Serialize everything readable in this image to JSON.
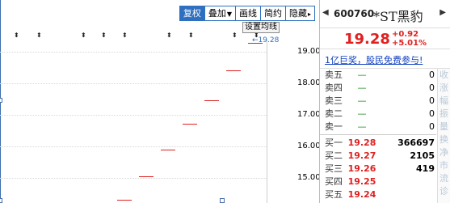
{
  "toolbar": {
    "items": [
      {
        "label": "复权",
        "active": true
      },
      {
        "label": "叠加",
        "caret": "▼"
      },
      {
        "label": "画线"
      },
      {
        "label": "简约"
      },
      {
        "label": "隐藏",
        "caret": "▸"
      }
    ]
  },
  "chart": {
    "set_ma_label": "设置均线",
    "high_label": "19.28",
    "y_ticks": [
      "19.00",
      "18.00",
      "17.00",
      "16.00",
      "15.00"
    ],
    "marker_glyph": "⬍"
  },
  "chart_data": {
    "type": "line",
    "title": "",
    "xlabel": "",
    "ylabel": "",
    "ylim": [
      14.2,
      19.4
    ],
    "y_ticks": [
      19.0,
      18.0,
      17.0,
      16.0,
      15.0
    ],
    "series": [
      {
        "values": [
          14.3,
          15.05,
          15.9,
          16.7,
          17.45,
          18.4,
          19.28
        ]
      }
    ]
  },
  "quote": {
    "nav_left": "◀",
    "code": "600760",
    "name": "*ST黑豹",
    "nav_right": "▶",
    "price": "19.28",
    "change": "+0.92",
    "change_pct": "+5.01%",
    "ad_text": "1亿巨奖，股民免费参与!",
    "sell": [
      {
        "label": "卖五",
        "price": "—",
        "vol": "0"
      },
      {
        "label": "卖四",
        "price": "—",
        "vol": "0"
      },
      {
        "label": "卖三",
        "price": "—",
        "vol": "0"
      },
      {
        "label": "卖二",
        "price": "—",
        "vol": "0"
      },
      {
        "label": "卖一",
        "price": "—",
        "vol": "0"
      }
    ],
    "buy": [
      {
        "label": "买一",
        "price": "19.28",
        "vol": "366697"
      },
      {
        "label": "买二",
        "price": "19.27",
        "vol": "2105"
      },
      {
        "label": "买三",
        "price": "19.26",
        "vol": "419"
      },
      {
        "label": "买四",
        "price": "19.25",
        "vol": ""
      },
      {
        "label": "买五",
        "price": "19.24",
        "vol": ""
      }
    ],
    "side_chars": [
      "收",
      "涨",
      "幅",
      "振",
      "量",
      "换",
      "净",
      "市",
      "流",
      "诊"
    ]
  },
  "colors": {
    "accent": "#2f6fbf",
    "up": "#e02020",
    "down": "#1a8a1a"
  }
}
